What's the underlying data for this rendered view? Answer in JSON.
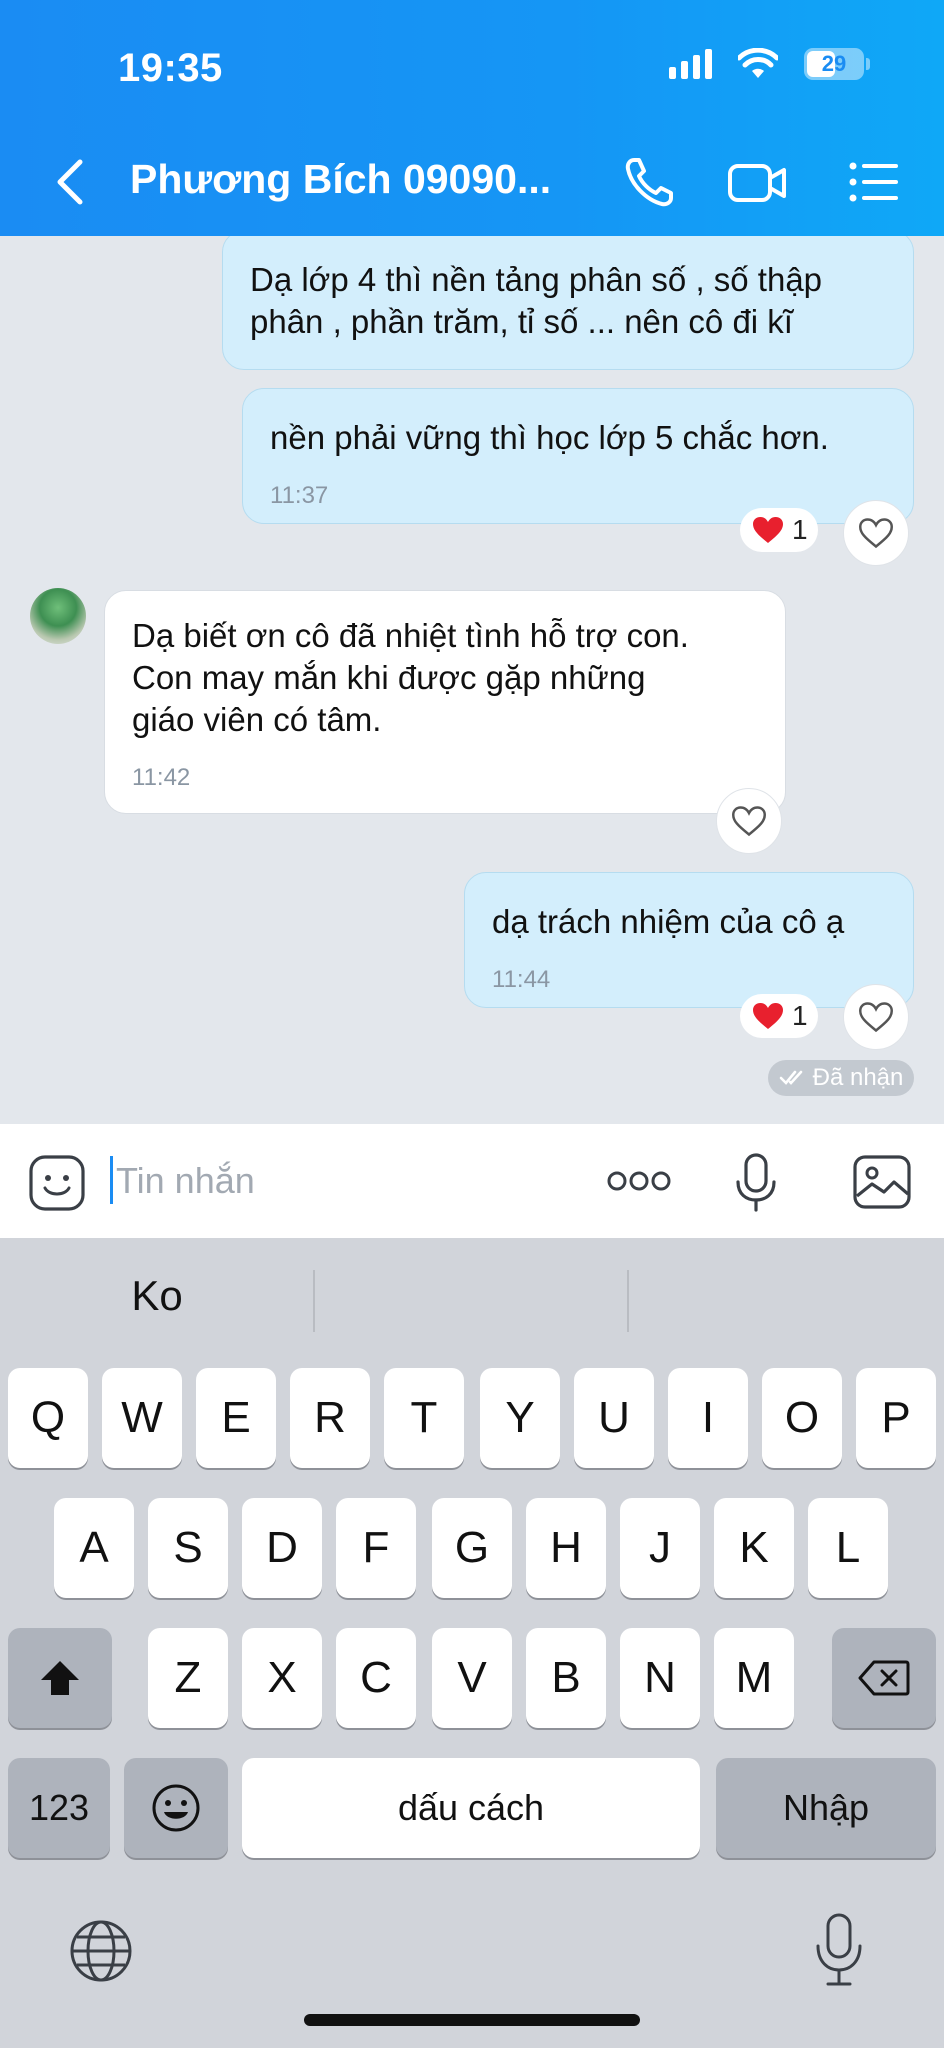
{
  "status_bar": {
    "time": "19:35",
    "battery": "29"
  },
  "header": {
    "title": "Phương Bích 09090..."
  },
  "messages": [
    {
      "direction": "out",
      "text_lines": [
        "Dạ lớp 4 thì nền tảng phân số , số thập",
        "phân , phần trăm, tỉ số ... nên cô đi kĩ"
      ]
    },
    {
      "direction": "out",
      "text": "nền phải vững thì học lớp 5 chắc hơn.",
      "time": "11:37",
      "reaction_count": "1"
    },
    {
      "direction": "in",
      "text_lines": [
        "Dạ biết ơn cô đã nhiệt tình hỗ trợ con.",
        "Con may mắn khi được gặp những",
        "giáo viên có tâm."
      ],
      "time": "11:42"
    },
    {
      "direction": "out",
      "text": "dạ trách nhiệm của cô ạ",
      "time": "11:44",
      "reaction_count": "1"
    }
  ],
  "seen_status": "Đã nhận",
  "composer": {
    "placeholder": "Tin nhắn"
  },
  "keyboard": {
    "suggestions": [
      "Ko",
      "",
      ""
    ],
    "row1": [
      "Q",
      "W",
      "E",
      "R",
      "T",
      "Y",
      "U",
      "I",
      "O",
      "P"
    ],
    "row2": [
      "A",
      "S",
      "D",
      "F",
      "G",
      "H",
      "J",
      "K",
      "L"
    ],
    "row3": [
      "Z",
      "X",
      "C",
      "V",
      "B",
      "N",
      "M"
    ],
    "numbers_key": "123",
    "space_key": "dấu cách",
    "enter_key": "Nhập"
  },
  "colors": {
    "header_blue": "#1a8cf3",
    "outgoing_bubble": "#d3eefc",
    "heart_red": "#e8202e"
  }
}
